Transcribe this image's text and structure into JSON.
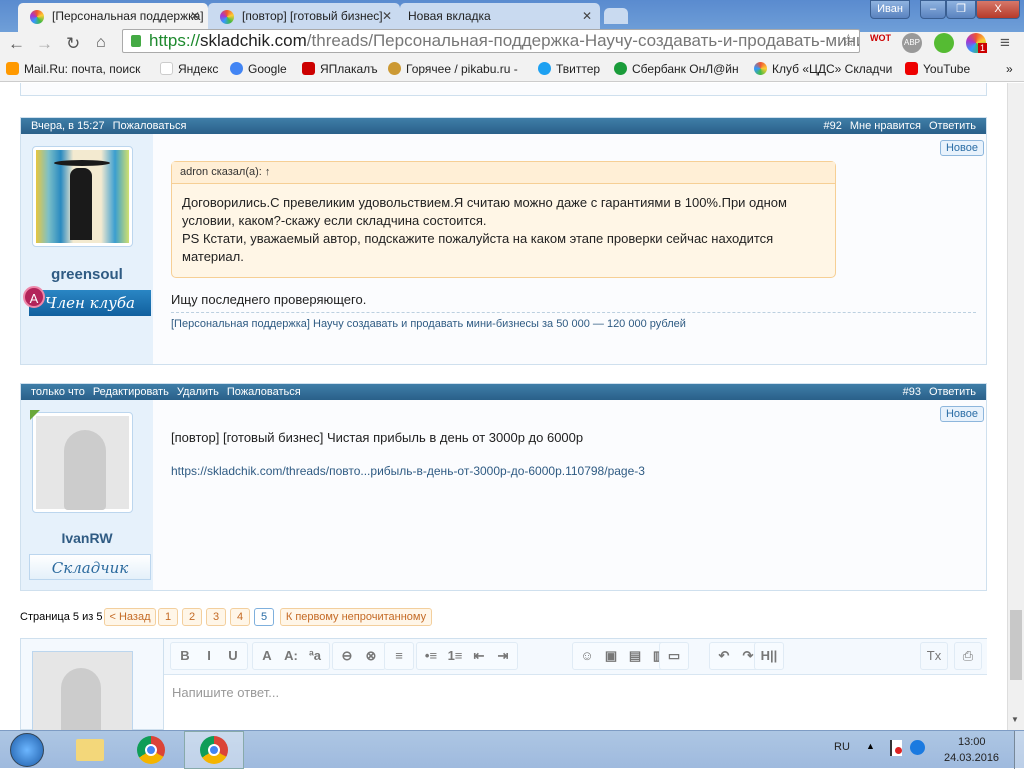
{
  "browser": {
    "tabs": [
      {
        "title": "[Персональная поддержка]"
      },
      {
        "title": "[повтор] [готовый бизнес]"
      },
      {
        "title": "Новая вкладка"
      }
    ],
    "user": "Иван",
    "url_scheme": "https://",
    "url_host": "skladchik.com",
    "url_path": "/threads/Персональная-поддержка-Научу-создавать-и-продавать-мини-",
    "extensions": [
      "WOT",
      "ABP",
      "1"
    ],
    "bookmarks": [
      "Mail.Ru: почта, поиск",
      "Яндекс",
      "Google",
      "ЯПлакалъ",
      "Горячее / pikabu.ru -",
      "Твиттер",
      "Сбербанк ОнЛ@йн",
      "Клуб «ЦДС» Складчи",
      "YouTube"
    ]
  },
  "post92": {
    "time": "Вчера, в 15:27",
    "report": "Пожаловаться",
    "number": "#92",
    "like": "Мне нравится",
    "reply": "Ответить",
    "username": "greensoul",
    "rank": "Член клуба",
    "rank_badge": "A",
    "new_badge": "Новое",
    "quote_author": "adron сказал(а): ↑",
    "quote_text": [
      "Договорились.С превеликим удовольствием.Я считаю можно даже с гарантиями в 100%.При одном",
      "условии, каком?-скажу если складчина состоится.",
      "PS Кстати, уважаемый автор, подскажите пожалуйста на каком этапе проверки сейчас находится",
      "материал."
    ],
    "text": "Ищу последнего проверяющего.",
    "signature": "[Персональная поддержка] Научу создавать и продавать мини-бизнесы за 50 000 — 120 000 рублей"
  },
  "post93": {
    "time": "только что",
    "edit": "Редактировать",
    "delete": "Удалить",
    "report": "Пожаловаться",
    "number": "#93",
    "reply": "Ответить",
    "username": "IvanRW",
    "rank": "Складчик",
    "new_badge": "Новое",
    "text": "[повтор] [готовый бизнес] Чистая прибыль в день от 3000р до 6000р",
    "link": "https://skladchik.com/threads/повто...рибыль-в-день-от-3000р-до-6000р.110798/page-3"
  },
  "pagination": {
    "label": "Страница 5 из 5",
    "prev": "< Назад",
    "pages": [
      "1",
      "2",
      "3",
      "4",
      "5"
    ],
    "current": "5",
    "first_unread": "К первому непрочитанному"
  },
  "editor": {
    "placeholder": "Напишите ответ...",
    "toolbar": [
      "B",
      "I",
      "U",
      "A",
      "A:",
      "ªa",
      "⊖",
      "⊗",
      "≡",
      "•≡",
      "1≡",
      "⇤",
      "⇥",
      "☺",
      "▣",
      "▤",
      "▥",
      "▭",
      "↶",
      "↷",
      "H||",
      "Tx",
      "⎙"
    ]
  },
  "taskbar": {
    "lang": "RU",
    "time": "13:00",
    "date": "24.03.2016"
  }
}
